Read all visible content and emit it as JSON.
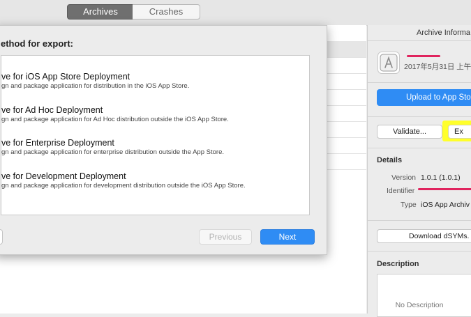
{
  "toolbar": {
    "tabs": [
      {
        "label": "Archives",
        "selected": true
      },
      {
        "label": "Crashes",
        "selected": false
      }
    ]
  },
  "sheet": {
    "title": "ethod for export:",
    "options": [
      {
        "title": "ve for iOS App Store Deployment",
        "desc": "gn and package application for distribution in the iOS App Store."
      },
      {
        "title": "ve for Ad Hoc Deployment",
        "desc": "gn and package application for Ad Hoc distribution outside the iOS App Store."
      },
      {
        "title": "ve for Enterprise Deployment",
        "desc": "gn and package application for enterprise distribution outside the App Store."
      },
      {
        "title": "ve for Development Deployment",
        "desc": "gn and package application for development distribution outside the iOS App Store."
      }
    ],
    "buttons": {
      "previous": "Previous",
      "next": "Next"
    }
  },
  "inspector": {
    "header": "Archive Informa",
    "date": "2017年5月31日 上午",
    "upload": "Upload to App Stor",
    "validate": "Validate...",
    "export": "Ex",
    "details_title": "Details",
    "version_label": "Version",
    "version_value": "1.0.1 (1.0.1)",
    "identifier_label": "Identifier",
    "type_label": "Type",
    "type_value": "iOS App Archiv",
    "dsyms": "Download dSYMs.",
    "description_title": "Description",
    "description_empty": "No Description"
  },
  "colors": {
    "accent": "#2f8cf4",
    "highlight": "#ffff2b",
    "redaction": "#e0245e"
  }
}
